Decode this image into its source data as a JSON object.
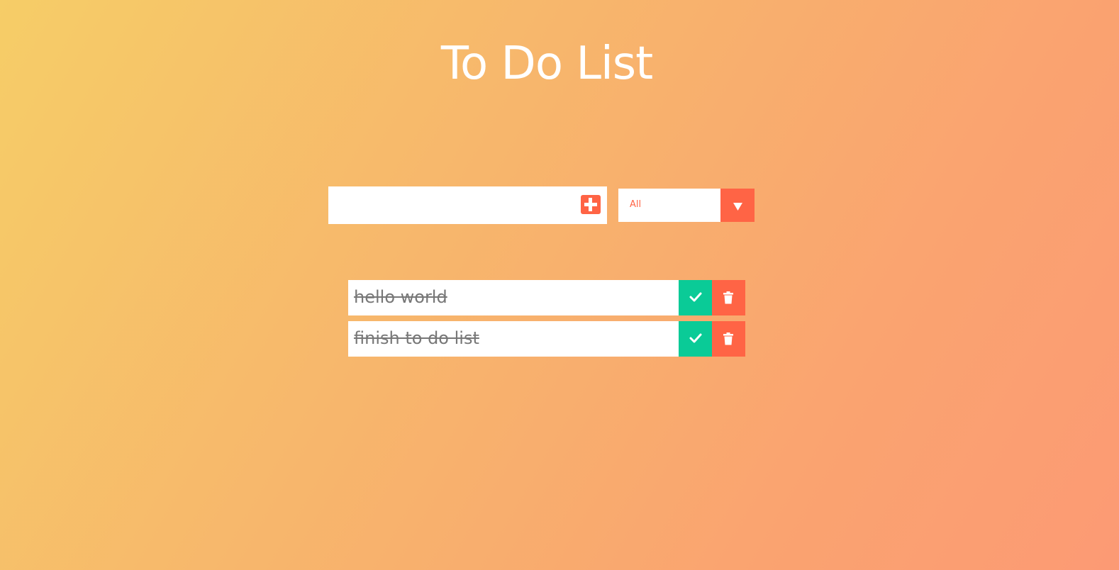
{
  "header": {
    "title": "To Do List"
  },
  "form": {
    "input_value": "",
    "input_placeholder": "",
    "add_icon": "plus-square-icon"
  },
  "filter": {
    "selected": "All",
    "arrow_icon": "caret-down-icon"
  },
  "todos": [
    {
      "text": "hello world",
      "completed": true
    },
    {
      "text": "finish to do list",
      "completed": true
    }
  ],
  "colors": {
    "accent": "#ff6445",
    "complete": "#0acb97",
    "gradient_start": "#f6cd67",
    "gradient_end": "#fc9a74"
  }
}
